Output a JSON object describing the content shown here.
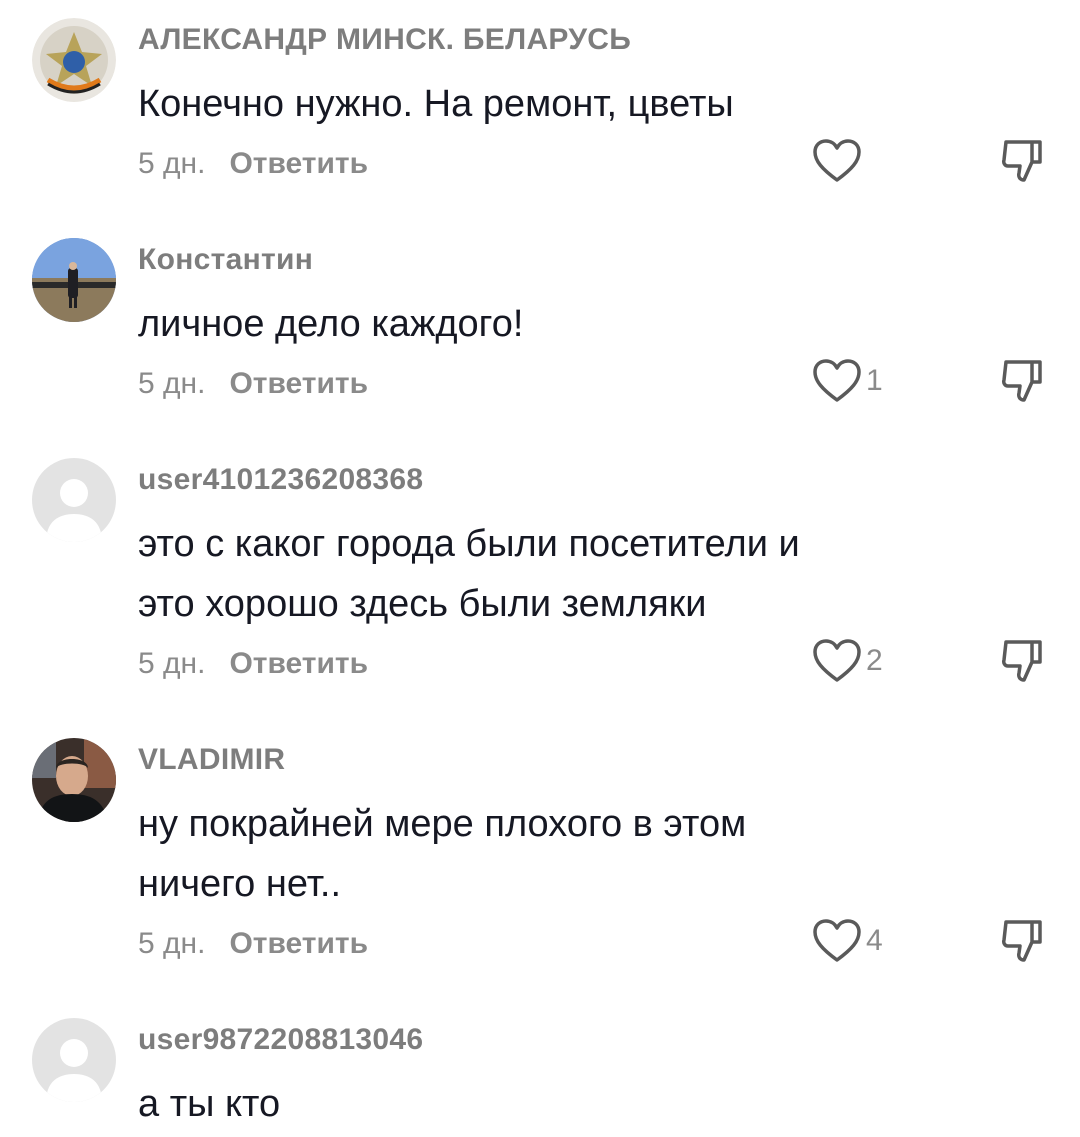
{
  "comments": [
    {
      "username": "АЛЕКСАНДР МИНСК. БЕЛАРУСЬ",
      "lines": [
        "Конечно нужно. На ремонт, цветы"
      ],
      "time": "5 дн.",
      "reply_label": "Ответить",
      "likes": "",
      "avatar": "emblem-avatar"
    },
    {
      "username": "Константин",
      "lines": [
        "личное дело каждого!"
      ],
      "time": "5 дн.",
      "reply_label": "Ответить",
      "likes": "1",
      "avatar": "photo-avatar-outdoor"
    },
    {
      "username": "user4101236208368",
      "lines": [
        "это с каког города были посетители и",
        "это хорошо здесь были земляки"
      ],
      "time": "5 дн.",
      "reply_label": "Ответить",
      "likes": "2",
      "avatar": "default-avatar"
    },
    {
      "username": "VLADIMIR",
      "lines": [
        "ну покрайней мере плохого в этом",
        "ничего нет.."
      ],
      "time": "5 дн.",
      "reply_label": "Ответить",
      "likes": "4",
      "avatar": "photo-avatar-portrait"
    },
    {
      "username": "user9872208813046",
      "lines": [
        "а ты кто"
      ],
      "time": "",
      "reply_label": "",
      "likes": "",
      "avatar": "default-avatar"
    }
  ],
  "icons": {
    "like": "heart-outline-icon",
    "dislike": "thumbs-down-icon"
  },
  "colors": {
    "text": "#161823",
    "muted": "#8a8a8a",
    "icon": "#5a5a5a"
  }
}
